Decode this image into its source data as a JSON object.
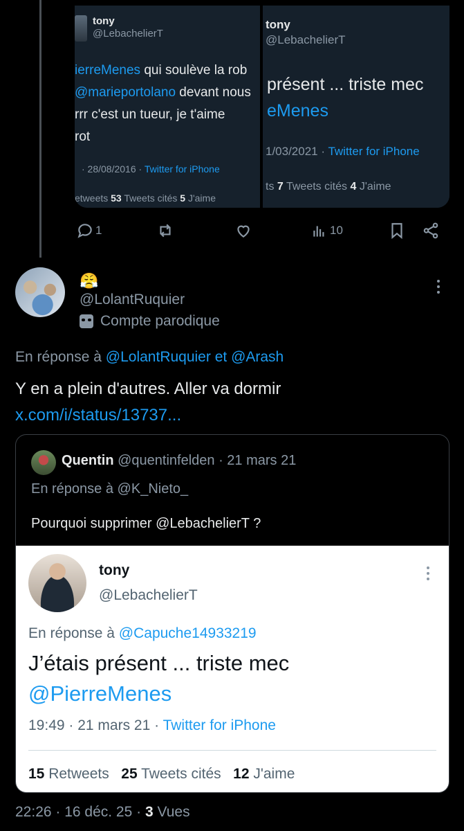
{
  "embedded_screenshot": {
    "left": {
      "name": "tony",
      "handle": "@LebachelierT",
      "lines": [
        "ierreMenes qui soulève la rob",
        "@marieportolano devant nous",
        "rrr c'est un tueur, je t'aime",
        "rot"
      ],
      "line1_mention": "ierreMenes",
      "line1_rest": " qui soulève la rob",
      "line2_mention": "@marieportolano",
      "line2_rest": " devant nous",
      "meta_date": "· 28/08/2016 ·",
      "meta_source": "Twitter for iPhone",
      "stat_prefix": "etweets",
      "stat_quotes_n": "53",
      "stat_quotes_label": "Tweets cités",
      "stat_likes_n": "5",
      "stat_likes_label": "J'aime"
    },
    "right": {
      "name": "tony",
      "handle": "@LebachelierT",
      "line1": "présent ... triste mec",
      "line2": "eMenes",
      "meta_date": "1/03/2021 ·",
      "meta_source": "Twitter for iPhone",
      "stat_prefix": "ts",
      "stat_quotes_n": "7",
      "stat_quotes_label": "Tweets cités",
      "stat_likes_n": "4",
      "stat_likes_label": "J'aime"
    }
  },
  "actions": {
    "reply_count": "1",
    "views_count": "10"
  },
  "tweet": {
    "emoji": "😤",
    "handle": "@LolantRuquier",
    "parody_label": "Compte parodique",
    "reply_prefix": "En réponse à",
    "reply_to_1": "@LolantRuquier",
    "reply_and": "et",
    "reply_to_2": "@Arash",
    "body": "Y en a plein d'autres. Aller va dormir",
    "link": "x.com/i/status/13737...",
    "footer_time": "22:26 · 16 déc. 25 ·",
    "footer_views_n": "3",
    "footer_views_label": "Vues"
  },
  "quote": {
    "name": "Quentin",
    "handle": "@quentinfelden",
    "date": "· 21 mars 21",
    "reply_prefix": "En réponse à",
    "reply_to": "@K_Nieto_",
    "text": "Pourquoi supprimer @LebachelierT ?"
  },
  "card": {
    "name": "tony",
    "handle": "@LebachelierT",
    "reply_prefix": "En réponse à",
    "reply_to": "@Capuche14933219",
    "text": "J’étais présent ... triste mec",
    "link": "@PierreMenes",
    "meta_time": "19:49 · 21 mars 21 ·",
    "meta_source": "Twitter for iPhone",
    "retweets_n": "15",
    "retweets_label": "Retweets",
    "quotes_n": "25",
    "quotes_label": "Tweets cités",
    "likes_n": "12",
    "likes_label": "J'aime"
  },
  "colors": {
    "background": "#000000",
    "accent": "#1d9bf0",
    "muted": "#8b98a5",
    "text": "#e7e9ea"
  }
}
